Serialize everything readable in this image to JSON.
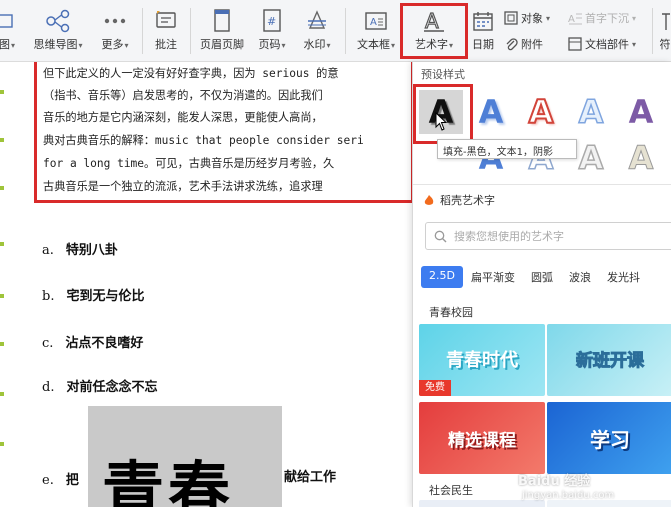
{
  "toolbar": {
    "partial_left": "图",
    "mindmap": "思维导图",
    "more": "更多",
    "annotation": "批注",
    "header_footer": "页眉页脚",
    "page_number": "页码",
    "watermark": "水印",
    "textbox": "文本框",
    "wordart": "艺术字",
    "date": "日期",
    "object": "对象",
    "attachment": "附件",
    "dropcap": "首字下沉",
    "doc_parts": "文档部件",
    "partial_right": "符"
  },
  "document": {
    "quote_lines": [
      "但下此定义的人一定没有好好查字典，因为 serious 的意",
      "（指书、音乐等）启发思考的，不仅为消遣的。因此我们",
      "音乐的地方是它内涵深刻，能发人深思，更能使人高尚，",
      "典对古典音乐的解释：music that people consider seri",
      "for a long time。可见，古典音乐是历经岁月考验，久",
      "古典音乐是一个独立的流派，艺术手法讲求洗练，追求理"
    ],
    "items": [
      {
        "letter": "a.",
        "text": "特别八卦"
      },
      {
        "letter": "b.",
        "text": "宅到无与伦比"
      },
      {
        "letter": "c.",
        "text": "沾点不良嗜好"
      },
      {
        "letter": "d.",
        "text": "对前任念念不忘"
      }
    ],
    "wordart_text": "青春",
    "item_e_letter": "e.",
    "item_e_before": "把",
    "item_e_after": "献给工作"
  },
  "panel": {
    "preset_title": "预设样式",
    "tooltip": "填充-黑色，文本1，阴影",
    "preset_glyph": "A",
    "shell_title": "稻壳艺术字",
    "search_placeholder": "搜索您想使用的艺术字",
    "tabs": [
      "2.5D",
      "扁平渐变",
      "圆弧",
      "波浪",
      "发光抖"
    ],
    "section1": "青春校园",
    "section2": "社会民生",
    "cards": [
      "青春时代",
      "新班开课",
      "精选课程",
      "学习"
    ],
    "free_badge": "免费",
    "watermark": "Baidu 经验",
    "watermark_sub": "jingyan.baidu.com"
  },
  "colors": {
    "highlight_red": "#d92a2a",
    "accent_blue": "#3d7cf0"
  }
}
